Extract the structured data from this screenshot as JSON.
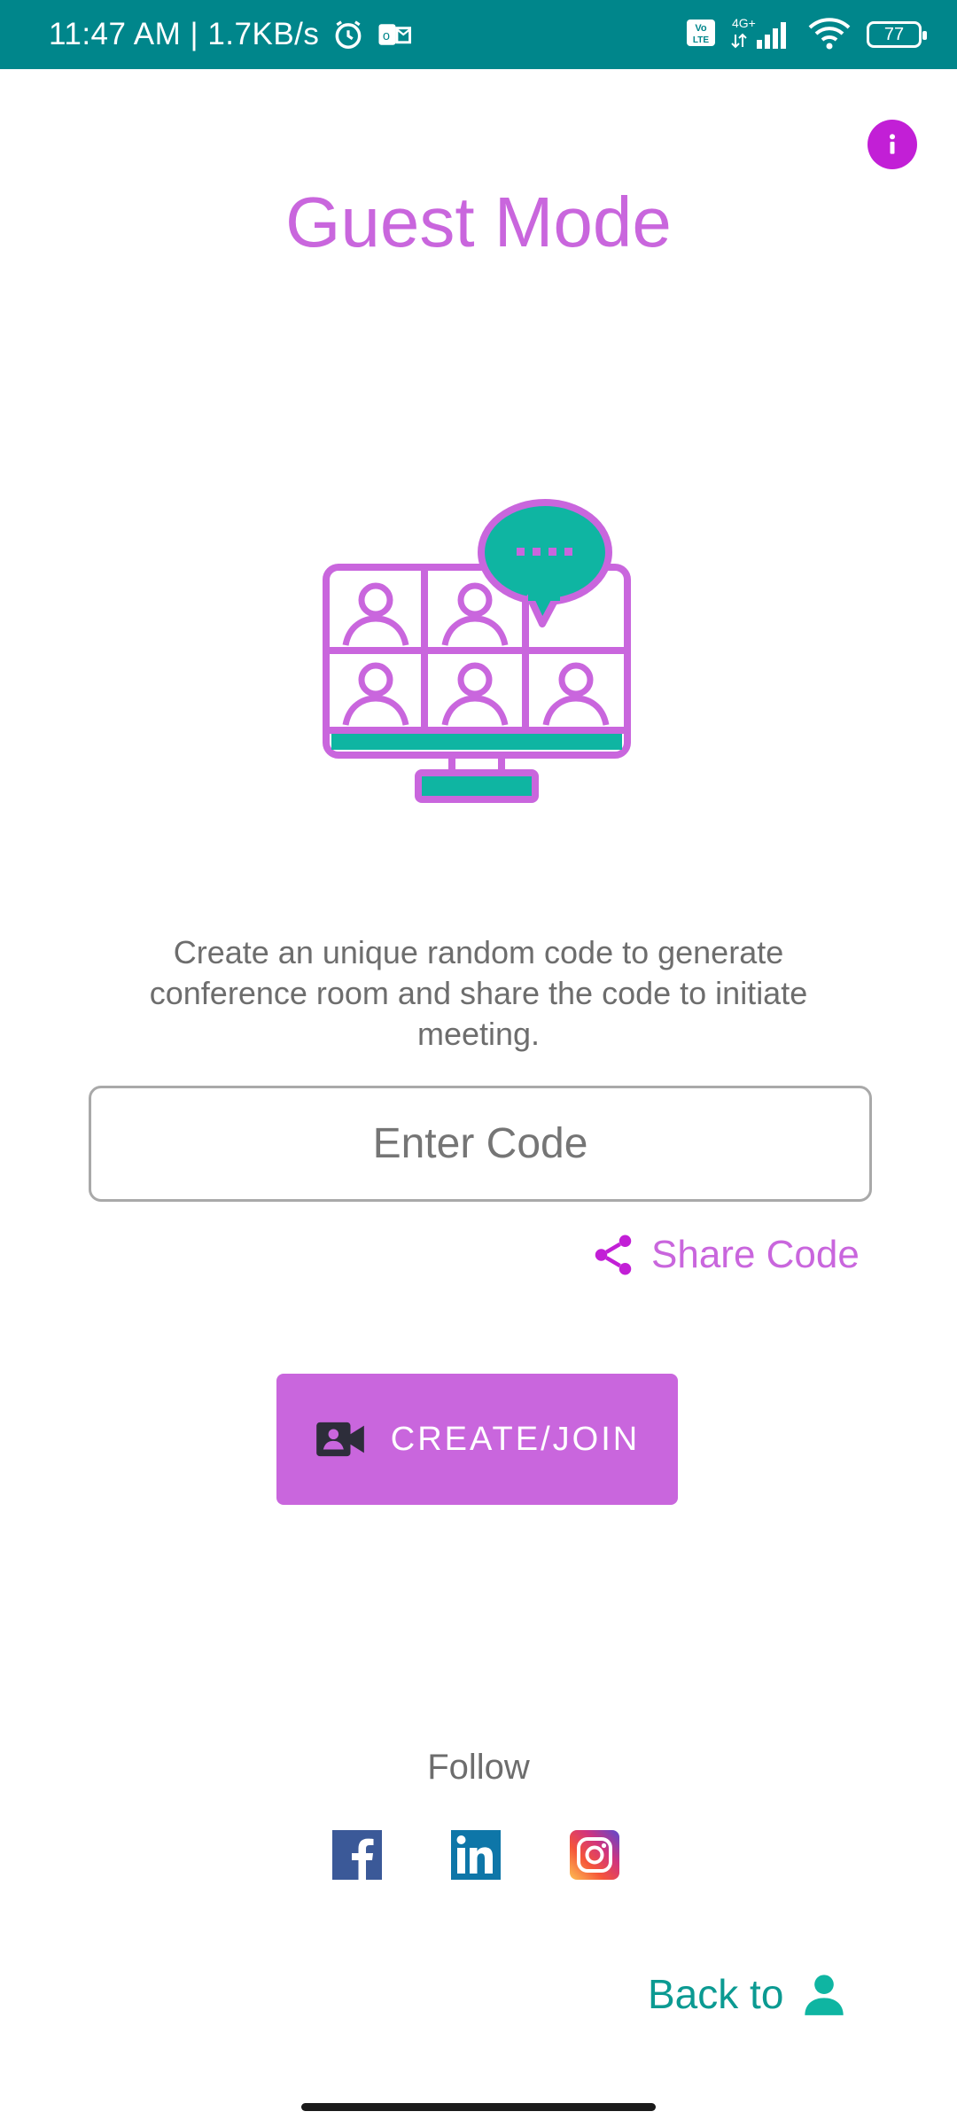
{
  "status_bar": {
    "time_speed": "11:47 AM | 1.7KB/s",
    "network": "4G+",
    "volte": "Vo LTE",
    "battery": "77"
  },
  "header": {
    "title": "Guest Mode"
  },
  "description": "Create an unique random code to generate conference room and share the code to initiate meeting.",
  "code_input": {
    "placeholder": "Enter Code"
  },
  "share": {
    "label": "Share Code"
  },
  "create_button": {
    "label": "CREATE/JOIN"
  },
  "follow": {
    "label": "Follow"
  },
  "back": {
    "label": "Back to"
  },
  "colors": {
    "accent": "#c966dd",
    "teal": "#00868b",
    "icon_teal": "#0fb5a2",
    "info": "#c21fd6"
  },
  "icons": [
    "alarm-icon",
    "outlook-icon",
    "signal-icon",
    "wifi-icon",
    "battery-icon",
    "info-icon",
    "video-conference-icon",
    "share-icon",
    "video-camera-icon",
    "facebook-icon",
    "linkedin-icon",
    "instagram-icon",
    "person-icon"
  ]
}
